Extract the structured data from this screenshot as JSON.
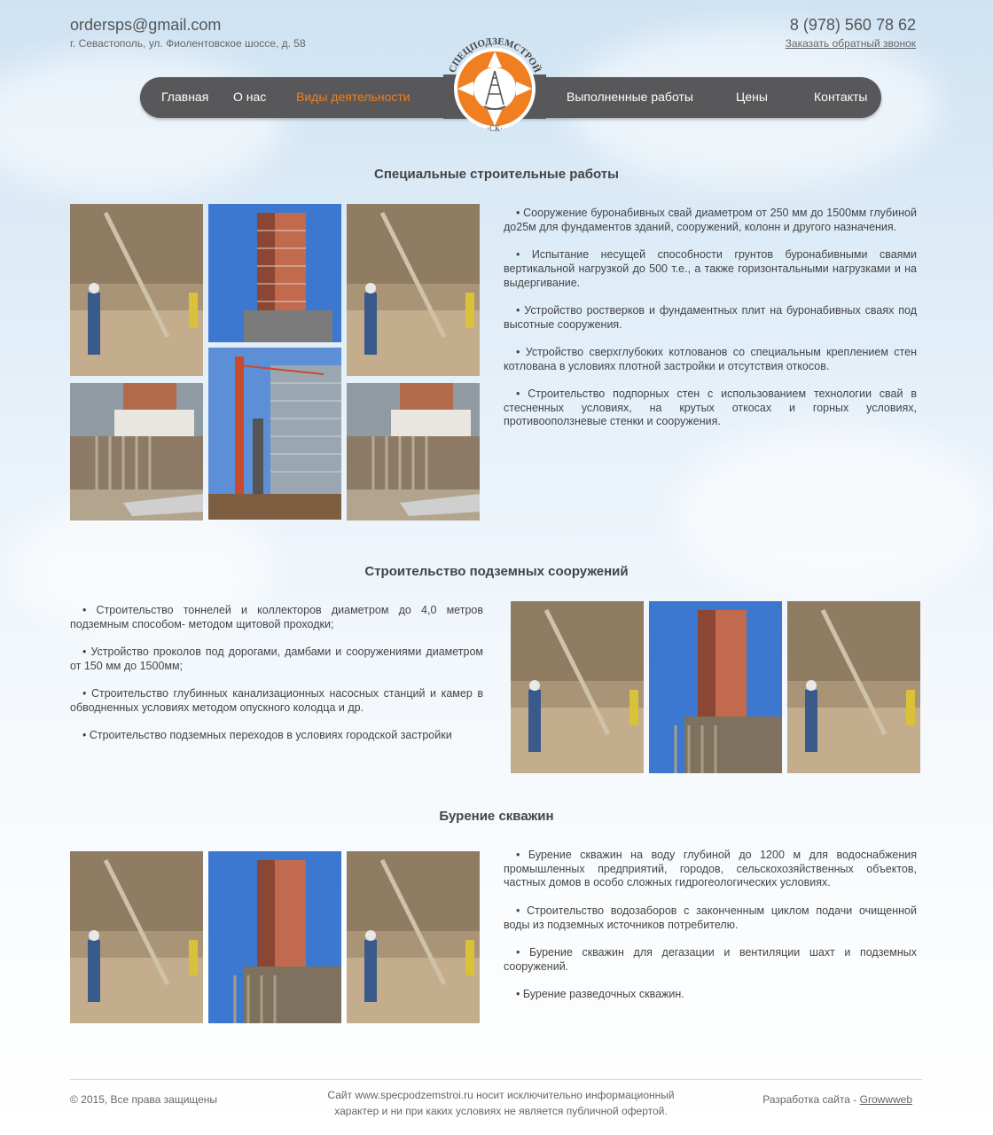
{
  "header": {
    "email": "ordersps@gmail.com",
    "address": "г. Севастополь, ул. Фиолентовское шоссе, д. 58",
    "phone": "8 (978) 560 78 62",
    "callback_link": "Заказать обратный звонок",
    "logo_arc_text": "СПЕЦПОДЗЕМСТРОЙ",
    "logo_bottom_text": "·СК·"
  },
  "nav": {
    "home": "Главная",
    "about": "О нас",
    "activities": "Виды деятельности",
    "completed": "Выполненные работы",
    "prices": "Цены",
    "contacts": "Контакты"
  },
  "sections": [
    {
      "title": "Специальные строительные работы",
      "items": [
        "• Сооружение буронабивных свай диаметром от 250 мм до 1500мм глубиной до25м для фундаментов зданий, сооружений, колонн и другого назначения.",
        "• Испытание несущей способности грунтов буронабивными сваями вертикальной нагрузкой до 500 т.е., а также горизонтальными нагрузками и на выдергивание.",
        "• Устройство ростверков и фундаментных плит на буронабивных сваях под высотные сооружения.",
        "• Устройство сверхглубоких котлованов со специальным креплением  стен котлована в условиях плотной застройки и отсутствия откосов.",
        "• Строительство подпорных стен с использованием технологии свай в стесненных условиях, на крутых откосах и горных условиях, противооползневые стенки и сооружения."
      ]
    },
    {
      "title": "Строительство подземных сооружений",
      "items": [
        "• Строительство тоннелей и коллекторов диаметром до 4,0 метров подземным способом- методом щитовой проходки;",
        "• Устройство проколов под дорогами, дамбами и сооружениями диаметром от 150 мм до 1500мм;",
        "• Строительство глубинных канализационных насосных станций и камер  в обводненных условиях методом опускного колодца и др.",
        "• Строительство подземных переходов в условиях городской застройки"
      ]
    },
    {
      "title": "Бурение скважин",
      "items": [
        "• Бурение скважин на воду глубиной до 1200 м для водоснабжения промышленных предприятий, городов, сельскохозяйственных  объектов, частных домов в особо сложных гидрогеологических условиях.",
        "• Строительство водозаборов с законченным циклом подачи очищенной воды из подземных источников потребителю.",
        "• Бурение скважин для дегазации и вентиляции шахт и подземных сооружений.",
        "• Бурение разведочных скважин."
      ]
    }
  ],
  "footer": {
    "copyright": "© 2015, Все права защищены",
    "disclaimer_line1": "Сайт www.specpodzemstroi.ru носит исключительно информационный",
    "disclaimer_line2": "характер и ни при каких условиях не является публичной офертой.",
    "dev_label": "Разработка сайта - ",
    "dev_link": "Growwweb"
  },
  "colors": {
    "accent": "#f07f22",
    "nav_bg": "#58585a"
  }
}
